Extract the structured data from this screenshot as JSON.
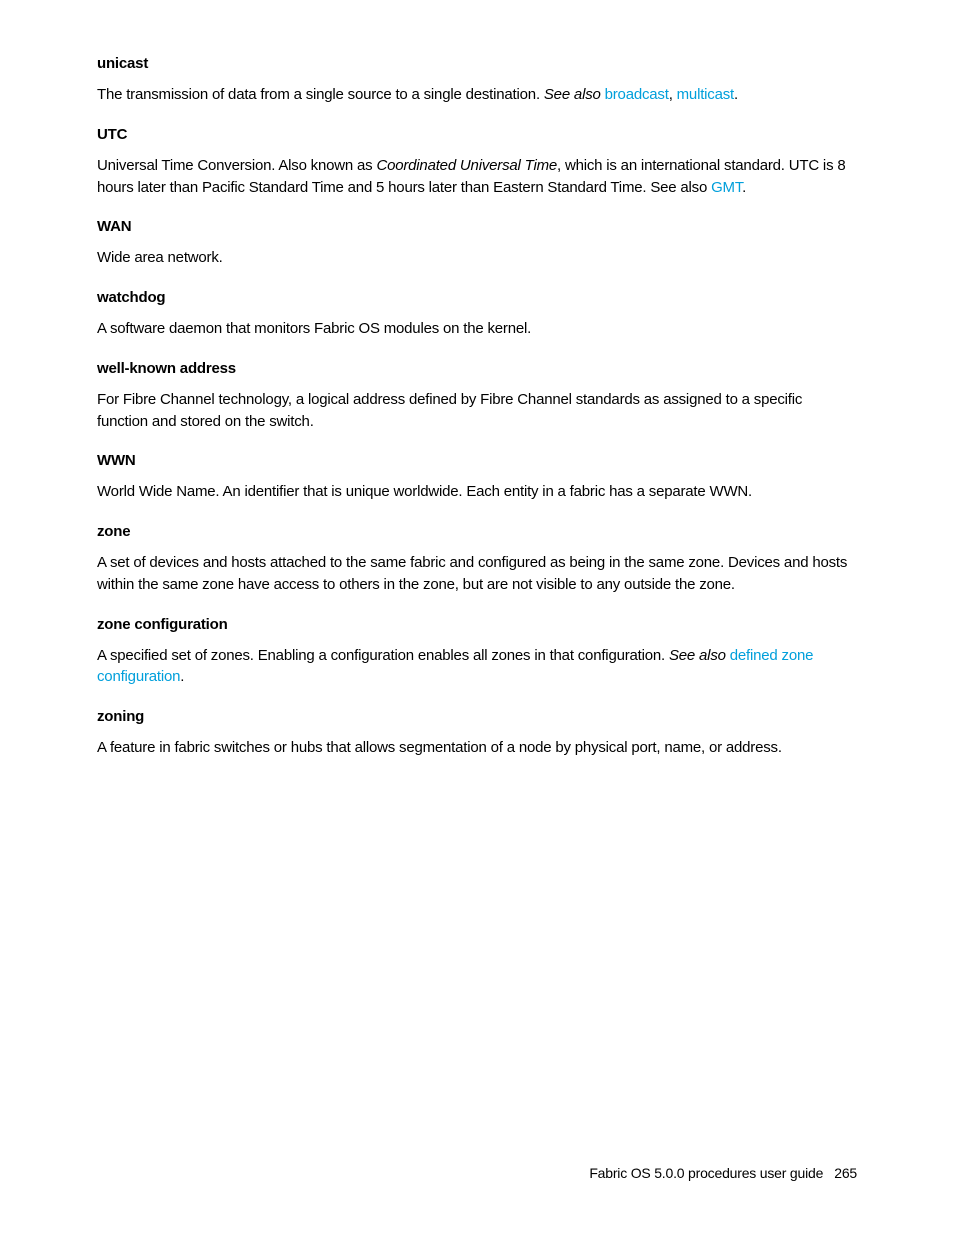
{
  "entries": [
    {
      "term": "unicast",
      "def_pre": "The transmission of data from a single source to a single destination. ",
      "see_also": "See also",
      "link1": "broadcast",
      "sep1": ", ",
      "link2": "multicast",
      "post": "."
    },
    {
      "term": "UTC",
      "def_pre": "Universal Time Conversion. Also known as ",
      "italic": "Coordinated Universal Time",
      "mid": ", which is an international standard. UTC is 8 hours later than Pacific Standard Time and 5 hours later than Eastern Standard Time. See also ",
      "link1": "GMT",
      "post": "."
    },
    {
      "term": "WAN",
      "def": "Wide area network."
    },
    {
      "term": "watchdog",
      "def": "A software daemon that monitors Fabric OS modules on the kernel."
    },
    {
      "term": "well-known address",
      "def": "For Fibre Channel technology, a logical address defined by Fibre Channel standards as assigned to a specific function and stored on the switch."
    },
    {
      "term": "WWN",
      "def": "World Wide Name. An identifier that is unique worldwide. Each entity in a fabric has a separate WWN."
    },
    {
      "term": "zone",
      "def": "A set of devices and hosts attached to the same fabric and configured as being in the same zone. Devices and hosts within the same zone have access to others in the zone, but are not visible to any outside the zone."
    },
    {
      "term": "zone configuration",
      "def_pre": "A specified set of zones. Enabling a configuration enables all zones in that configuration. ",
      "see_also": "See also",
      "link1": "defined zone configuration",
      "post": "."
    },
    {
      "term": "zoning",
      "def": "A feature in fabric switches or hubs that allows segmentation of a node by physical port, name, or address."
    }
  ],
  "footer": {
    "text": "Fabric OS 5.0.0 procedures user guide",
    "page": "265"
  }
}
